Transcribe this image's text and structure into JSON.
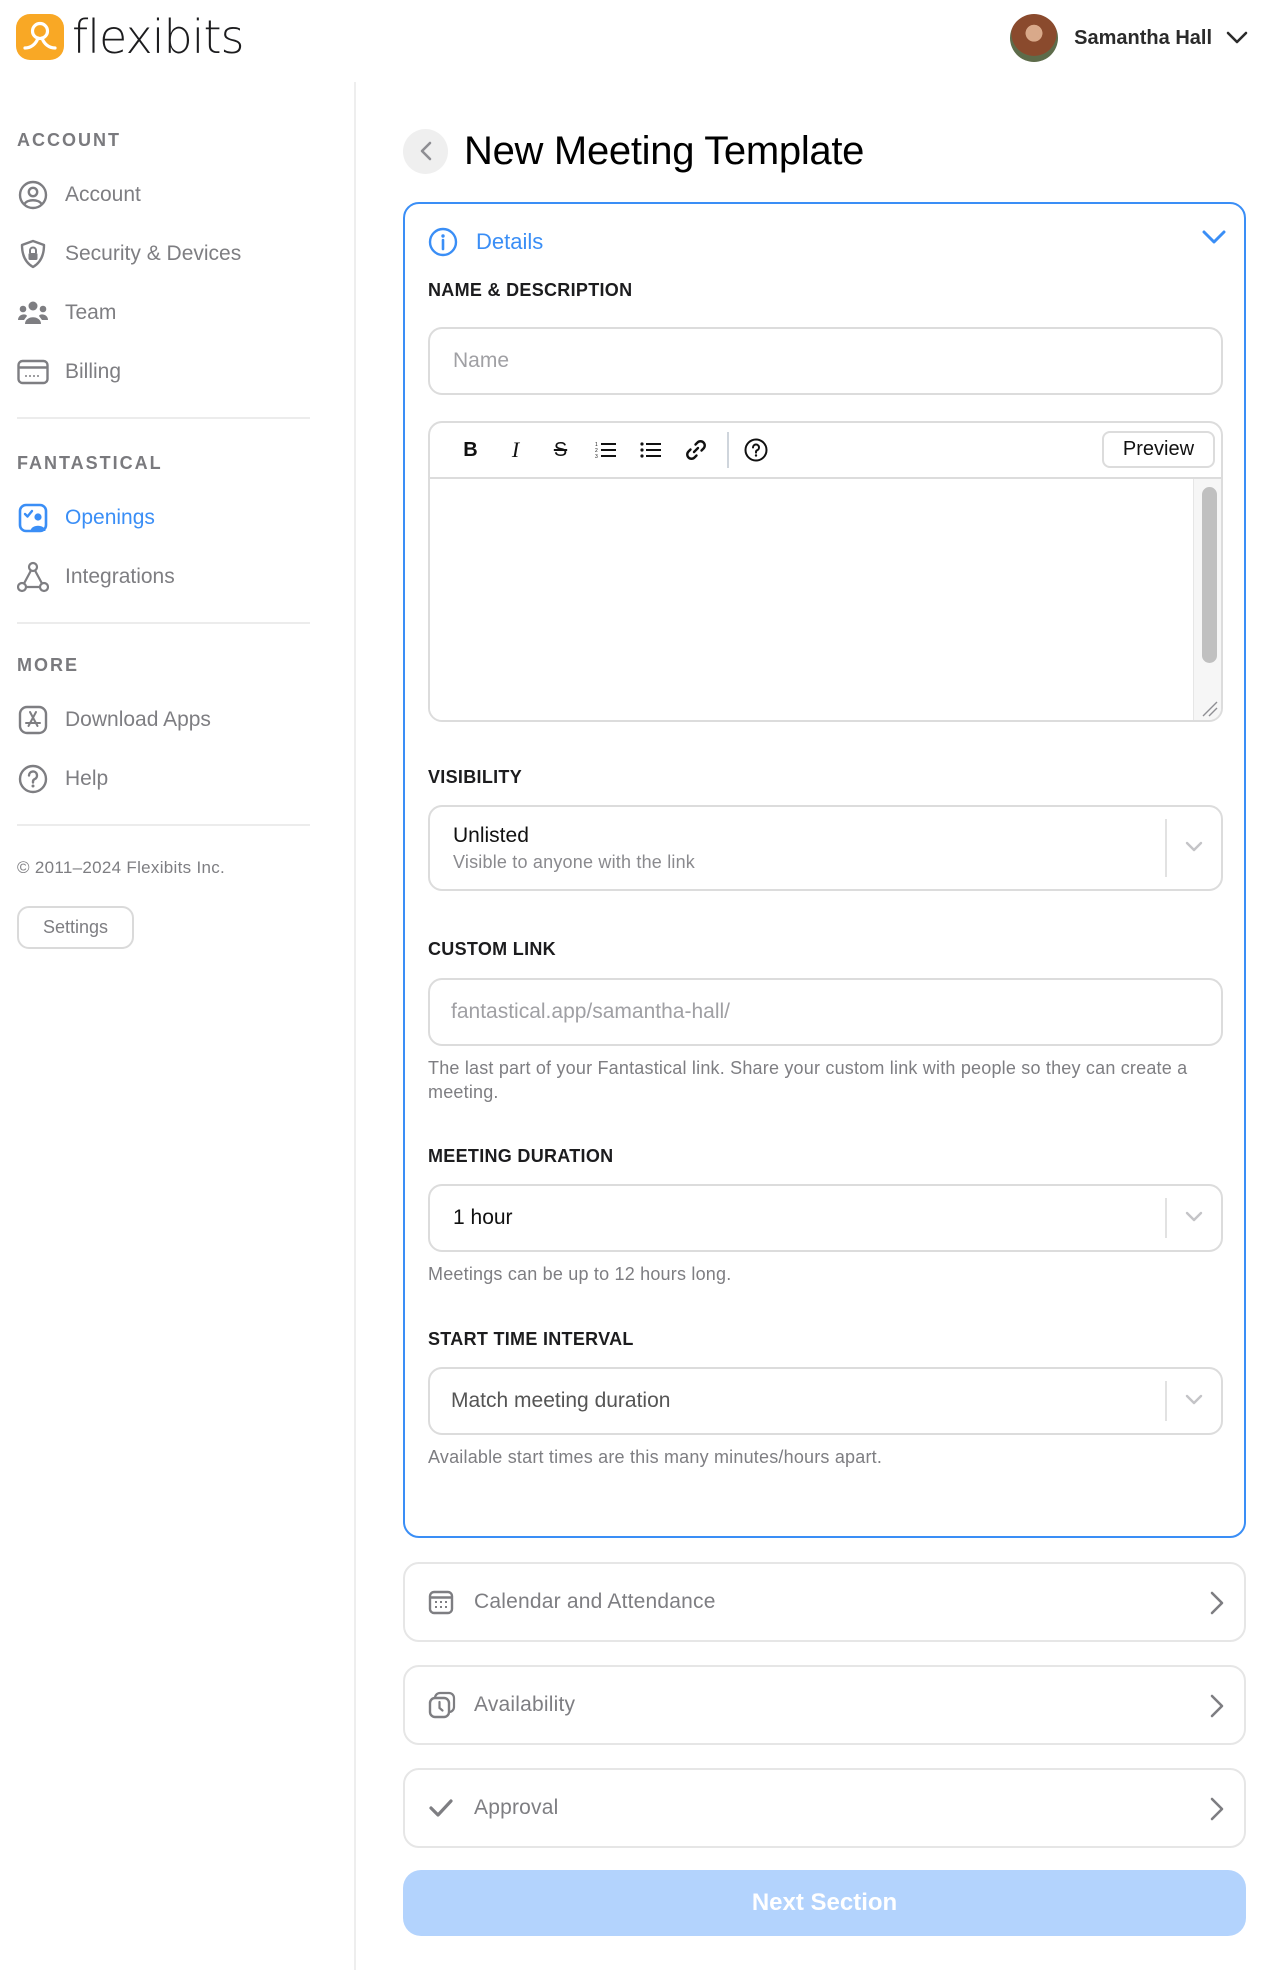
{
  "brand": {
    "name": "flexibits",
    "accent": "#f9a825"
  },
  "user": {
    "name": "Samantha Hall"
  },
  "sidebar": {
    "sections": [
      {
        "heading": "ACCOUNT",
        "items": [
          {
            "label": "Account",
            "icon": "person-circle-icon"
          },
          {
            "label": "Security & Devices",
            "icon": "shield-lock-icon"
          },
          {
            "label": "Team",
            "icon": "people-icon"
          },
          {
            "label": "Billing",
            "icon": "credit-card-icon"
          }
        ]
      },
      {
        "heading": "FANTASTICAL",
        "items": [
          {
            "label": "Openings",
            "icon": "openings-icon",
            "active": true
          },
          {
            "label": "Integrations",
            "icon": "integrations-icon"
          }
        ]
      },
      {
        "heading": "MORE",
        "items": [
          {
            "label": "Download Apps",
            "icon": "app-store-icon"
          },
          {
            "label": "Help",
            "icon": "help-icon"
          }
        ]
      }
    ],
    "copyright": "© 2011–2024 Flexibits Inc.",
    "settings_label": "Settings"
  },
  "main": {
    "title": "New Meeting Template",
    "details": {
      "title": "Details",
      "name_section_label": "NAME & DESCRIPTION",
      "name_placeholder": "Name",
      "name_value": "",
      "description_value": "",
      "toolbar": {
        "bold": "B",
        "italic": "I",
        "strike": "S",
        "preview_label": "Preview"
      },
      "visibility": {
        "label": "VISIBILITY",
        "value": "Unlisted",
        "description": "Visible to anyone with the link"
      },
      "custom_link": {
        "label": "CUSTOM LINK",
        "placeholder": "fantastical.app/samantha-hall/",
        "help": "The last part of your Fantastical link. Share your custom link with people so they can create a meeting."
      },
      "duration": {
        "label": "MEETING DURATION",
        "value": "1 hour",
        "help": "Meetings can be up to 12 hours long."
      },
      "start_interval": {
        "label": "START TIME INTERVAL",
        "value": "Match meeting duration",
        "help": "Available start times are this many minutes/hours apart."
      }
    },
    "sections": [
      {
        "label": "Calendar and Attendance",
        "icon": "calendar-icon"
      },
      {
        "label": "Availability",
        "icon": "availability-clock-icon"
      },
      {
        "label": "Approval",
        "icon": "checkmark-icon"
      }
    ],
    "next_label": "Next Section",
    "colors": {
      "primary": "#3a8ef6",
      "disabled_button": "#b3d3fd"
    }
  }
}
